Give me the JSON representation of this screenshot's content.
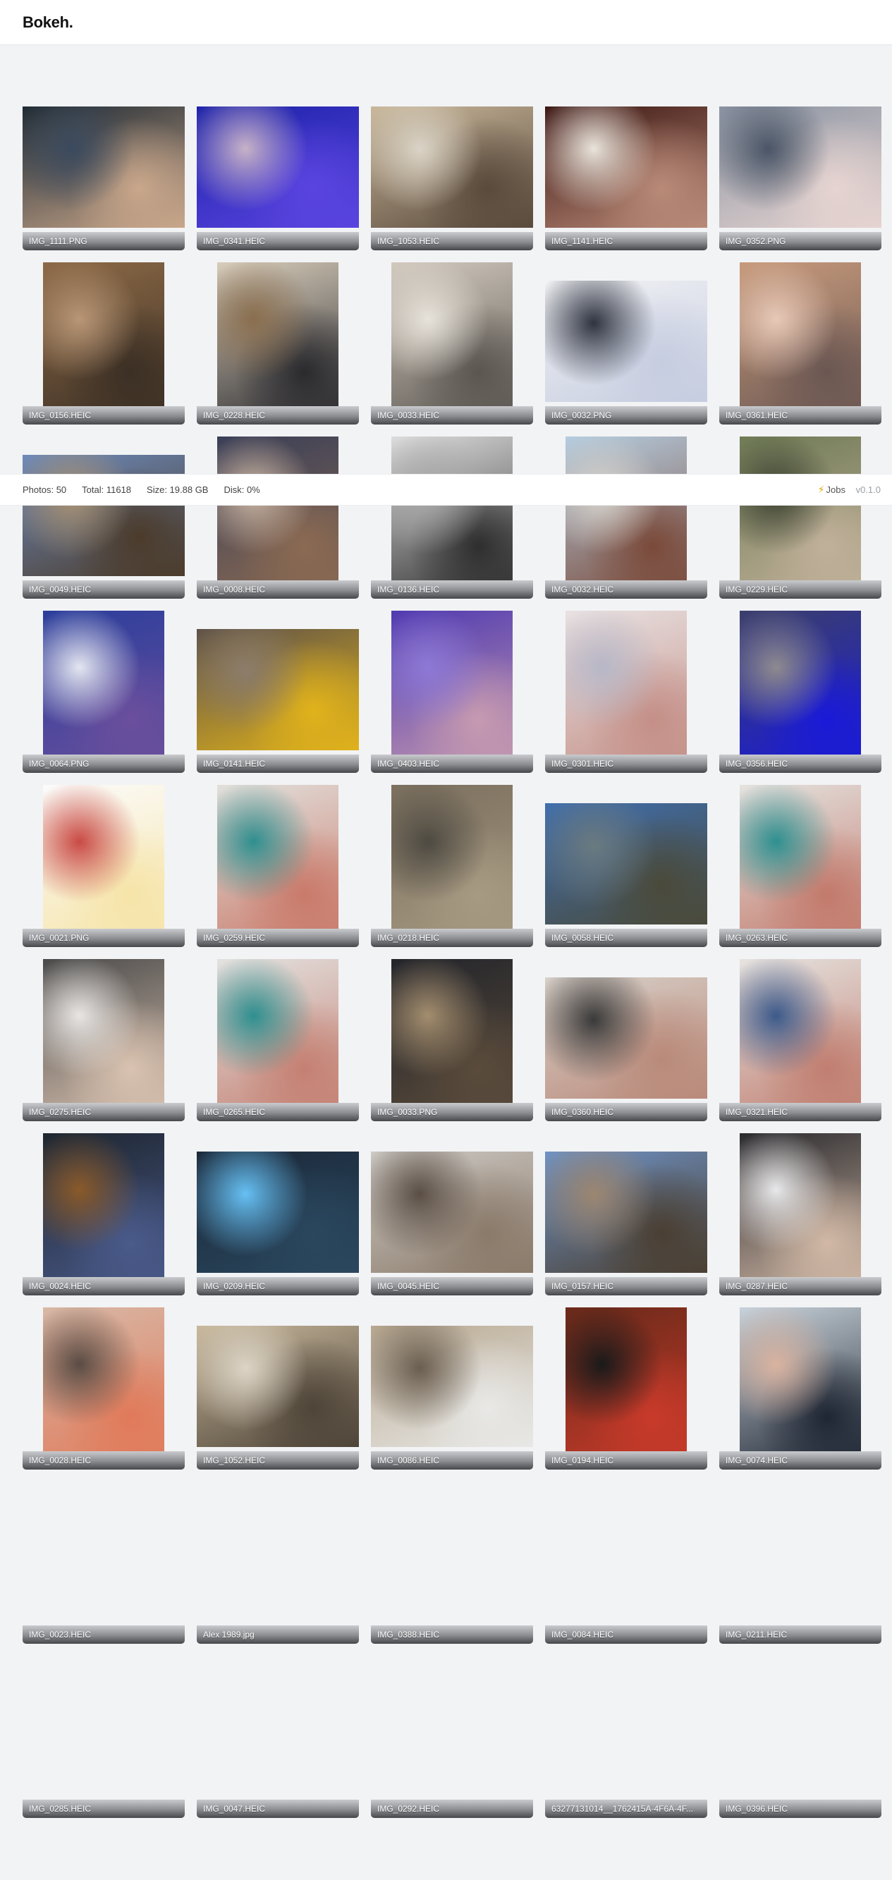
{
  "app": {
    "title": "Bokeh."
  },
  "status": {
    "photos": "Photos: 50",
    "total": "Total: 11618",
    "size": "Size: 19.88 GB",
    "disk": "Disk: 0%",
    "jobs_label": "Jobs",
    "version": "v0.1.0"
  },
  "photos": [
    {
      "name": "IMG_1111.PNG",
      "shape": "land",
      "colors": [
        "#1f2a33",
        "#c9a78b",
        "#3b4a5e"
      ]
    },
    {
      "name": "IMG_0341.HEIC",
      "shape": "land",
      "colors": [
        "#1c22a8",
        "#5a44e0",
        "#c7b2c8"
      ]
    },
    {
      "name": "IMG_1053.HEIC",
      "shape": "land",
      "colors": [
        "#c9b79a",
        "#5a4a3c",
        "#dad3c6"
      ]
    },
    {
      "name": "IMG_1141.HEIC",
      "shape": "land",
      "colors": [
        "#3a1511",
        "#b98a78",
        "#e9e4db"
      ]
    },
    {
      "name": "IMG_0352.PNG",
      "shape": "land",
      "colors": [
        "#8a93a2",
        "#e6d4d1",
        "#4a5566"
      ]
    },
    {
      "name": "IMG_0156.HEIC",
      "shape": "port",
      "colors": [
        "#8d6a47",
        "#3b2f24",
        "#b89676"
      ]
    },
    {
      "name": "IMG_0228.HEIC",
      "shape": "port",
      "colors": [
        "#d8cdbb",
        "#2a2a2e",
        "#8a6e4e"
      ]
    },
    {
      "name": "IMG_0033.HEIC",
      "shape": "port",
      "colors": [
        "#d3cabf",
        "#5a5650",
        "#e7e2da"
      ]
    },
    {
      "name": "IMG_0032.PNG",
      "shape": "land",
      "colors": [
        "#f3f3f5",
        "#c6cde0",
        "#2e3340"
      ]
    },
    {
      "name": "IMG_0361.HEIC",
      "shape": "port",
      "colors": [
        "#c79a7c",
        "#6b5752",
        "#e7c8b7"
      ]
    },
    {
      "name": "IMG_0049.HEIC",
      "shape": "land",
      "colors": [
        "#6d8bbd",
        "#4b3b2b",
        "#a89171"
      ]
    },
    {
      "name": "IMG_0008.HEIC",
      "shape": "port",
      "colors": [
        "#3a3f57",
        "#8b6a52",
        "#cdb7a4"
      ]
    },
    {
      "name": "IMG_0136.HEIC",
      "shape": "port",
      "colors": [
        "#dcdcdc",
        "#2e2e2e",
        "#a8a8a8"
      ]
    },
    {
      "name": "IMG_0032.HEIC",
      "shape": "port",
      "colors": [
        "#b5cde0",
        "#7a4a3a",
        "#d8d3cb"
      ]
    },
    {
      "name": "IMG_0229.HEIC",
      "shape": "port",
      "colors": [
        "#6f7a55",
        "#c1b19a",
        "#3b4130"
      ]
    },
    {
      "name": "IMG_0064.PNG",
      "shape": "port",
      "colors": [
        "#2b3e9b",
        "#6a4f9c",
        "#e3e6f0"
      ]
    },
    {
      "name": "IMG_0141.HEIC",
      "shape": "land",
      "colors": [
        "#5d5148",
        "#e0b21b",
        "#8c7c6b"
      ]
    },
    {
      "name": "IMG_0403.HEIC",
      "shape": "port",
      "colors": [
        "#4f3ab0",
        "#c69ab0",
        "#8d79d6"
      ]
    },
    {
      "name": "IMG_0301.HEIC",
      "shape": "port",
      "colors": [
        "#e8e2e2",
        "#c48f87",
        "#b7b7c7"
      ]
    },
    {
      "name": "IMG_0356.HEIC",
      "shape": "port",
      "colors": [
        "#3b3f6b",
        "#1a1ad8",
        "#8e8a90"
      ]
    },
    {
      "name": "IMG_0021.PNG",
      "shape": "port",
      "colors": [
        "#fbfbfb",
        "#f6e4a8",
        "#c94a45"
      ]
    },
    {
      "name": "IMG_0259.HEIC",
      "shape": "port",
      "colors": [
        "#e2e0dc",
        "#c97a6a",
        "#2f8f8f"
      ]
    },
    {
      "name": "IMG_0218.HEIC",
      "shape": "port",
      "colors": [
        "#7b6f5e",
        "#a79a82",
        "#4e4a42"
      ]
    },
    {
      "name": "IMG_0058.HEIC",
      "shape": "land",
      "colors": [
        "#3f6fb0",
        "#4a4a3a",
        "#6a7a80"
      ]
    },
    {
      "name": "IMG_0263.HEIC",
      "shape": "port",
      "colors": [
        "#e4e2df",
        "#c27a6c",
        "#2d9090"
      ]
    },
    {
      "name": "IMG_0275.HEIC",
      "shape": "port",
      "colors": [
        "#4a4a4a",
        "#d9c2b0",
        "#e8e6e4"
      ]
    },
    {
      "name": "IMG_0265.HEIC",
      "shape": "port",
      "colors": [
        "#e3e2e0",
        "#c48072",
        "#2e8f8f"
      ]
    },
    {
      "name": "IMG_0033.PNG",
      "shape": "port",
      "colors": [
        "#23252b",
        "#5a4b3b",
        "#a38d6e"
      ]
    },
    {
      "name": "IMG_0360.HEIC",
      "shape": "land",
      "colors": [
        "#d9d2cb",
        "#b98a7a",
        "#3a3a3a"
      ]
    },
    {
      "name": "IMG_0321.HEIC",
      "shape": "port",
      "colors": [
        "#e6e3e0",
        "#c07e70",
        "#3c5a8a"
      ]
    },
    {
      "name": "IMG_0024.HEIC",
      "shape": "port",
      "colors": [
        "#1e2630",
        "#4a5a8a",
        "#8a5a2a"
      ]
    },
    {
      "name": "IMG_0209.HEIC",
      "shape": "land",
      "colors": [
        "#1b2838",
        "#2a475e",
        "#66c0f4"
      ]
    },
    {
      "name": "IMG_0045.HEIC",
      "shape": "land",
      "colors": [
        "#cfcbc6",
        "#8a7a6a",
        "#5a4e45"
      ]
    },
    {
      "name": "IMG_0157.HEIC",
      "shape": "land",
      "colors": [
        "#6f93c6",
        "#4a3f32",
        "#9c8670"
      ]
    },
    {
      "name": "IMG_0287.HEIC",
      "shape": "port",
      "colors": [
        "#2a2a2e",
        "#d2b9a6",
        "#e8e8ea"
      ]
    },
    {
      "name": "IMG_0028.HEIC",
      "shape": "port",
      "colors": [
        "#d8b8a6",
        "#e07a5a",
        "#5a4c44"
      ]
    },
    {
      "name": "IMG_1052.HEIC",
      "shape": "land",
      "colors": [
        "#c8b89c",
        "#4e4438",
        "#dcd4c6"
      ]
    },
    {
      "name": "IMG_0086.HEIC",
      "shape": "land",
      "colors": [
        "#b8a890",
        "#e8e8e6",
        "#6a5e50"
      ]
    },
    {
      "name": "IMG_0194.HEIC",
      "shape": "port",
      "colors": [
        "#6a2a1a",
        "#c83a2a",
        "#1a1a1a"
      ]
    },
    {
      "name": "IMG_0074.HEIC",
      "shape": "port",
      "colors": [
        "#c8d2da",
        "#1f2633",
        "#d9b3a0"
      ]
    },
    {
      "name": "IMG_0023.HEIC",
      "shape": "none",
      "colors": [
        "#f2f3f5",
        "#f2f3f5",
        "#f2f3f5"
      ]
    },
    {
      "name": "Alex 1989.jpg",
      "shape": "none",
      "colors": [
        "#f2f3f5",
        "#f2f3f5",
        "#f2f3f5"
      ]
    },
    {
      "name": "IMG_0388.HEIC",
      "shape": "none",
      "colors": [
        "#f2f3f5",
        "#f2f3f5",
        "#f2f3f5"
      ]
    },
    {
      "name": "IMG_0084.HEIC",
      "shape": "none",
      "colors": [
        "#f2f3f5",
        "#f2f3f5",
        "#f2f3f5"
      ]
    },
    {
      "name": "IMG_0211.HEIC",
      "shape": "none",
      "colors": [
        "#f2f3f5",
        "#f2f3f5",
        "#f2f3f5"
      ]
    },
    {
      "name": "IMG_0285.HEIC",
      "shape": "none",
      "colors": [
        "#f2f3f5",
        "#f2f3f5",
        "#f2f3f5"
      ]
    },
    {
      "name": "IMG_0047.HEIC",
      "shape": "none",
      "colors": [
        "#f2f3f5",
        "#f2f3f5",
        "#f2f3f5"
      ]
    },
    {
      "name": "IMG_0292.HEIC",
      "shape": "none",
      "colors": [
        "#f2f3f5",
        "#f2f3f5",
        "#f2f3f5"
      ]
    },
    {
      "name": "63277131014__1762415A-4F6A-4F...",
      "shape": "none",
      "colors": [
        "#f2f3f5",
        "#f2f3f5",
        "#f2f3f5"
      ]
    },
    {
      "name": "IMG_0396.HEIC",
      "shape": "none",
      "colors": [
        "#f2f3f5",
        "#f2f3f5",
        "#f2f3f5"
      ]
    }
  ]
}
